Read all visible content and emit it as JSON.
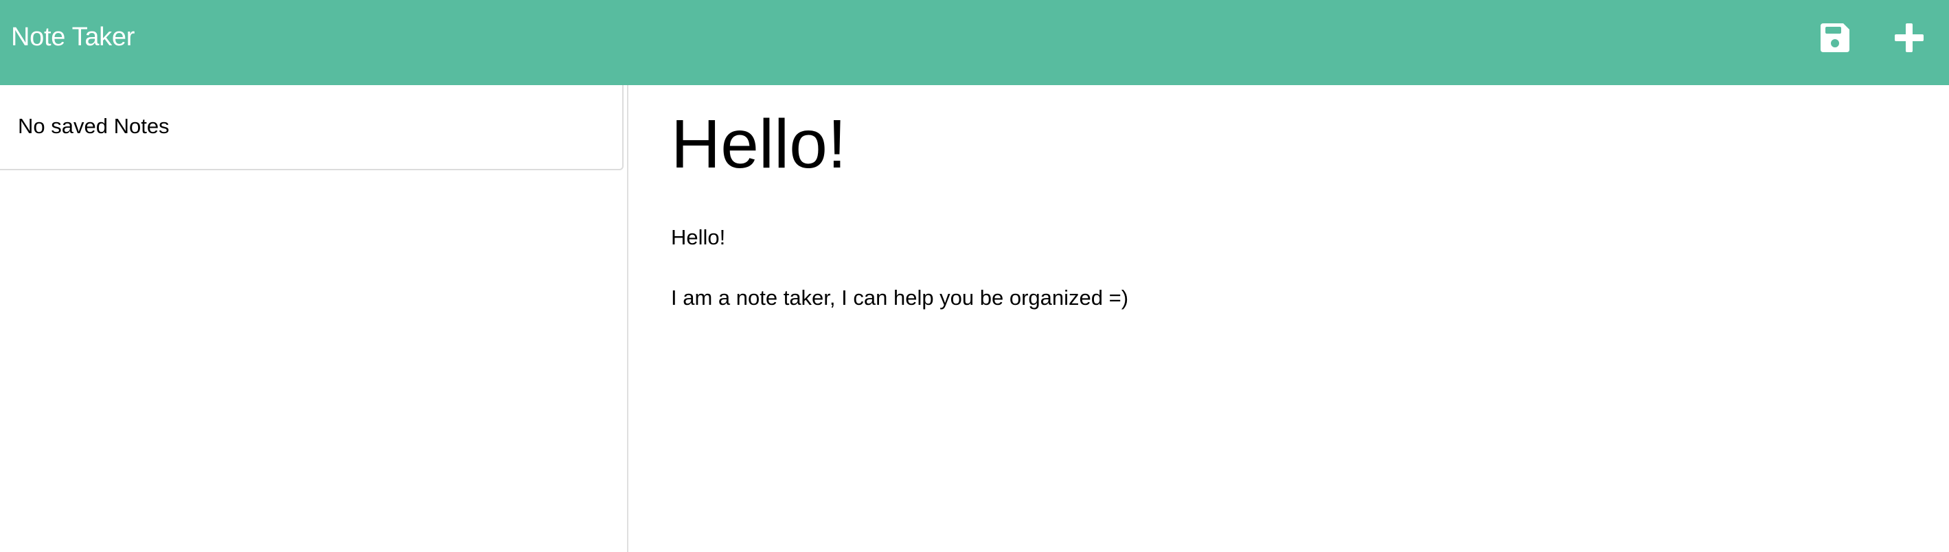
{
  "navbar": {
    "brand": "Note Taker",
    "background": "#58bc9f",
    "icons": [
      "save-icon",
      "plus-icon"
    ]
  },
  "sidebar": {
    "empty_message": "No saved Notes"
  },
  "editor": {
    "title": "Hello!",
    "text_line_1": "Hello!",
    "text_line_2": "I am a note taker, I can help you be organized =)"
  }
}
